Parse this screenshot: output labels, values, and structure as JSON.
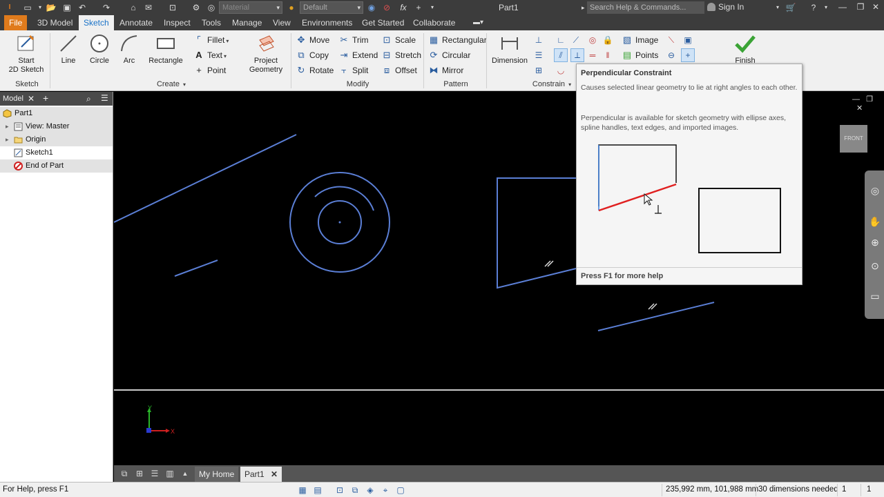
{
  "titlebar": {
    "title": "Part1",
    "material_placeholder": "Material",
    "appearance_value": "Default",
    "fx_label": "fx",
    "help_placeholder": "Search Help & Commands...",
    "signin_label": "Sign In"
  },
  "menu": {
    "tabs": [
      "File",
      "3D Model",
      "Sketch",
      "Annotate",
      "Inspect",
      "Tools",
      "Manage",
      "View",
      "Environments",
      "Get Started",
      "Collaborate"
    ],
    "active": "Sketch"
  },
  "ribbon": {
    "sketch_group": {
      "label": "Sketch",
      "start_label_1": "Start",
      "start_label_2": "2D Sketch"
    },
    "create_group": {
      "label": "Create",
      "line": "Line",
      "circle": "Circle",
      "arc": "Arc",
      "rectangle": "Rectangle",
      "fillet": "Fillet",
      "text": "Text",
      "point": "Point",
      "project_1": "Project",
      "project_2": "Geometry"
    },
    "modify_group": {
      "label": "Modify",
      "move": "Move",
      "copy": "Copy",
      "rotate": "Rotate",
      "trim": "Trim",
      "extend": "Extend",
      "split": "Split",
      "scale": "Scale",
      "stretch": "Stretch",
      "offset": "Offset"
    },
    "pattern_group": {
      "label": "Pattern",
      "rectangular": "Rectangular",
      "circular": "Circular",
      "mirror": "Mirror"
    },
    "constrain_group": {
      "label": "Constrain",
      "dimension": "Dimension"
    },
    "insert_group": {
      "image": "Image",
      "points": "Points"
    },
    "finish": "Finish"
  },
  "browser": {
    "tab_label": "Model",
    "nodes": [
      {
        "label": "Part1"
      },
      {
        "label": "View: Master"
      },
      {
        "label": "Origin"
      },
      {
        "label": "Sketch1"
      },
      {
        "label": "End of Part"
      }
    ]
  },
  "tooltip": {
    "title": "Perpendicular Constraint",
    "desc": "Causes selected linear geometry to lie at right angles to each other.",
    "detail": "Perpendicular is available for sketch geometry with ellipse axes, spline handles, text edges, and imported images.",
    "footer": "Press F1 for more help"
  },
  "viewcube_label": "FRONT",
  "axis": {
    "x": "X",
    "y": "Y"
  },
  "doc_tabs": {
    "home": "My Home",
    "part": "Part1"
  },
  "status": {
    "help": "For Help, press F1",
    "coords": "235,992 mm, 101,988 mm",
    "dims": "30 dimensions needed",
    "count1": "1",
    "count2": "1"
  },
  "colors": {
    "sketch_line": "#5b7fd6",
    "file_tab": "#e07b1c",
    "active_tab_text": "#1a73c8",
    "finish_check": "#3aa335",
    "tooltip_red": "#e02020"
  }
}
